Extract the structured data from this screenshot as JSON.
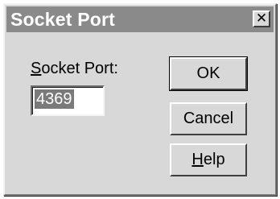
{
  "window": {
    "title": "Socket Port",
    "close_glyph": "✕"
  },
  "form": {
    "label_first": "S",
    "label_rest": "ocket Port:",
    "port_value": "4369"
  },
  "buttons": {
    "ok": "OK",
    "cancel": "Cancel",
    "help_first": "H",
    "help_rest": "elp"
  }
}
